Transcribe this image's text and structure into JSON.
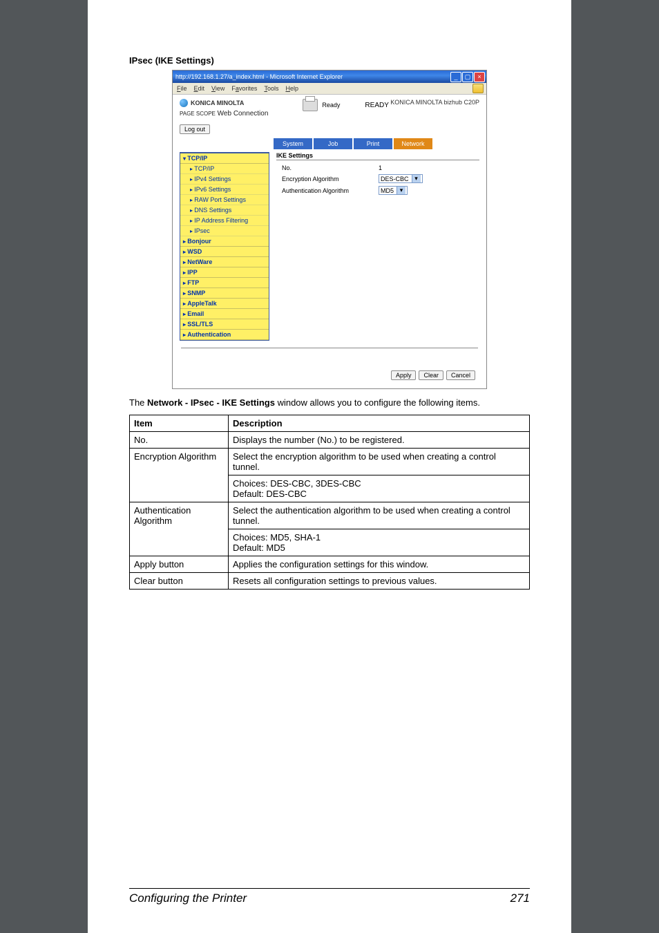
{
  "heading": "IPsec (IKE Settings)",
  "window": {
    "title": "http://192.168.1.27/a_index.html - Microsoft Internet Explorer",
    "menu": {
      "file": "File",
      "edit": "Edit",
      "view": "View",
      "favorites": "Favorites",
      "tools": "Tools",
      "help": "Help"
    },
    "brand": {
      "name": "KONICA MINOLTA",
      "scope_prefix": "PAGE SCOPE",
      "scope": "Web Connection"
    },
    "status": {
      "ready": "Ready",
      "ready_big": "READY"
    },
    "model": "KONICA MINOLTA bizhub C20P",
    "logout": "Log out",
    "tabs": {
      "system": "System",
      "job": "Job",
      "print": "Print",
      "network": "Network"
    },
    "nav": {
      "tcpip": "TCP/IP",
      "subs": [
        "TCP/IP",
        "IPv4 Settings",
        "IPv6 Settings",
        "RAW Port Settings",
        "DNS Settings",
        "IP Address Filtering",
        "IPsec"
      ],
      "cats": [
        "Bonjour",
        "WSD",
        "NetWare",
        "IPP",
        "FTP",
        "SNMP",
        "AppleTalk",
        "Email",
        "SSL/TLS",
        "Authentication"
      ]
    },
    "form": {
      "title": "IKE Settings",
      "rows": [
        {
          "label": "No.",
          "value": "1"
        },
        {
          "label": "Encryption Algorithm",
          "value": "DES-CBC"
        },
        {
          "label": "Authentication Algorithm",
          "value": "MD5"
        }
      ]
    },
    "buttons": {
      "apply": "Apply",
      "clear": "Clear",
      "cancel": "Cancel"
    }
  },
  "paragraph_pre": "The ",
  "paragraph_bold": "Network - IPsec - IKE Settings",
  "paragraph_post": " window allows you to configure the following items.",
  "table": {
    "headers": {
      "item": "Item",
      "desc": "Description"
    },
    "rows": [
      {
        "item": "No.",
        "desc": "Displays the number (No.) to be registered."
      },
      {
        "item": "Encryption Algorithm",
        "desc": "Select the encryption algorithm to be used when creating a control tunnel.",
        "extra": "Choices: DES-CBC, 3DES-CBC\nDefault:  DES-CBC"
      },
      {
        "item": "Authentication Algorithm",
        "desc": "Select the authentication algorithm to be used when creating a control tunnel.",
        "extra": "Choices: MD5, SHA-1\nDefault:  MD5"
      },
      {
        "item": "Apply button",
        "desc": "Applies the configuration settings for this window."
      },
      {
        "item": "Clear button",
        "desc": "Resets all configuration settings to previous values."
      }
    ]
  },
  "footer": {
    "title": "Configuring the Printer",
    "page": "271"
  }
}
